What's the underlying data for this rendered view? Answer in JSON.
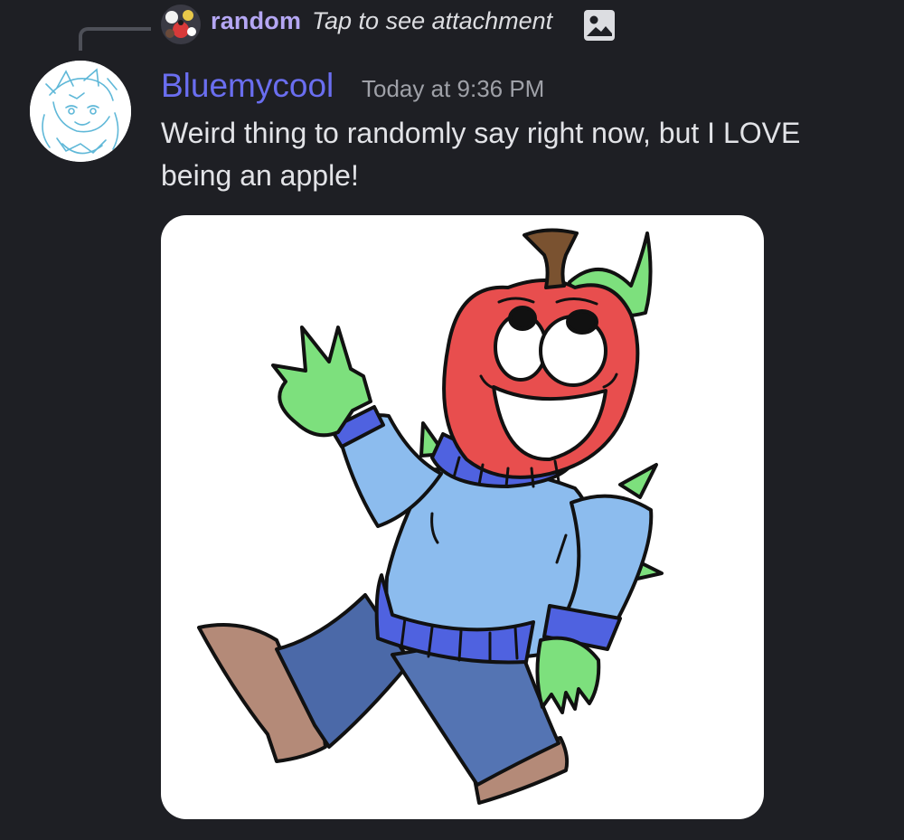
{
  "reply": {
    "username": "random",
    "text": "Tap to see attachment",
    "icon": "image-icon"
  },
  "message": {
    "username": "Bluemycool",
    "timestamp": "Today at 9:36 PM",
    "text": "Weird thing to randomly say right now, but I LOVE being an apple!"
  },
  "attachment": {
    "type": "image",
    "subject": "apple-character-drawing"
  },
  "colors": {
    "background": "#1e1f24",
    "username": "#6a6ef0",
    "reply_username": "#b5a7f4",
    "text": "#e2e3e7",
    "timestamp": "#9fa1a8"
  }
}
